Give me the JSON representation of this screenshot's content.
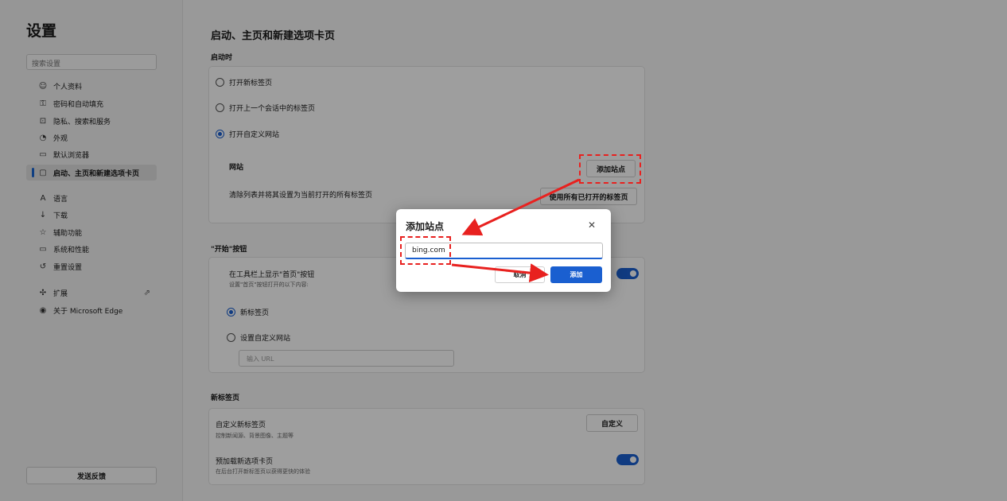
{
  "sidebar": {
    "title": "设置",
    "search_placeholder": "搜索设置",
    "items": [
      {
        "label": "个人资料",
        "icon": "profile-icon",
        "glyph": "☺"
      },
      {
        "label": "密码和自动填充",
        "icon": "key-icon",
        "glyph": "⚿"
      },
      {
        "label": "隐私、搜索和服务",
        "icon": "lock-icon",
        "glyph": "⊡"
      },
      {
        "label": "外观",
        "icon": "appearance-icon",
        "glyph": "◔"
      },
      {
        "label": "默认浏览器",
        "icon": "browser-icon",
        "glyph": "▭"
      },
      {
        "label": "启动、主页和新建选项卡页",
        "icon": "home-tab-icon",
        "glyph": "▢"
      },
      {
        "label": "语言",
        "icon": "language-icon",
        "glyph": "A"
      },
      {
        "label": "下载",
        "icon": "download-icon",
        "glyph": "↓"
      },
      {
        "label": "辅助功能",
        "icon": "accessibility-icon",
        "glyph": "☆"
      },
      {
        "label": "系统和性能",
        "icon": "system-icon",
        "glyph": "▭"
      },
      {
        "label": "重置设置",
        "icon": "reset-icon",
        "glyph": "↺"
      },
      {
        "label": "扩展",
        "icon": "extension-icon",
        "glyph": "✣"
      },
      {
        "label": "关于 Microsoft Edge",
        "icon": "edge-icon",
        "glyph": "◉"
      }
    ],
    "feedback_label": "发送反馈"
  },
  "main": {
    "page_title": "启动、主页和新建选项卡页",
    "startup": {
      "label": "启动时",
      "options": [
        "打开新标签页",
        "打开上一个会话中的标签页",
        "打开自定义网站"
      ],
      "selected": 2,
      "sites_label": "网站",
      "add_site_button": "添加站点",
      "clear_text": "清除列表并将其设置为当前打开的所有标签页",
      "use_open_tabs_button": "使用所有已打开的标签页"
    },
    "home_button": {
      "label": "\"开始\"按钮",
      "show_title": "在工具栏上显示\"首页\"按钮",
      "show_desc": "设置\"首页\"按钮打开的以下内容:",
      "toggle_on": true,
      "options": [
        "新标签页",
        "设置自定义网站"
      ],
      "selected": 0,
      "url_placeholder": "输入 URL"
    },
    "new_tab": {
      "label": "新标签页",
      "customize_title": "自定义新标签页",
      "customize_desc": "控制新闻源、背景图像、主题等",
      "customize_button": "自定义",
      "preload_title": "预加载新选项卡页",
      "preload_desc": "在后台打开新标签页以获得更快的体验",
      "preload_on": true
    }
  },
  "dialog": {
    "title": "添加站点",
    "input_value": "bing.com",
    "cancel_label": "取消",
    "add_label": "添加"
  },
  "colors": {
    "accent": "#1a5fd0",
    "annotation": "#e8211f"
  }
}
